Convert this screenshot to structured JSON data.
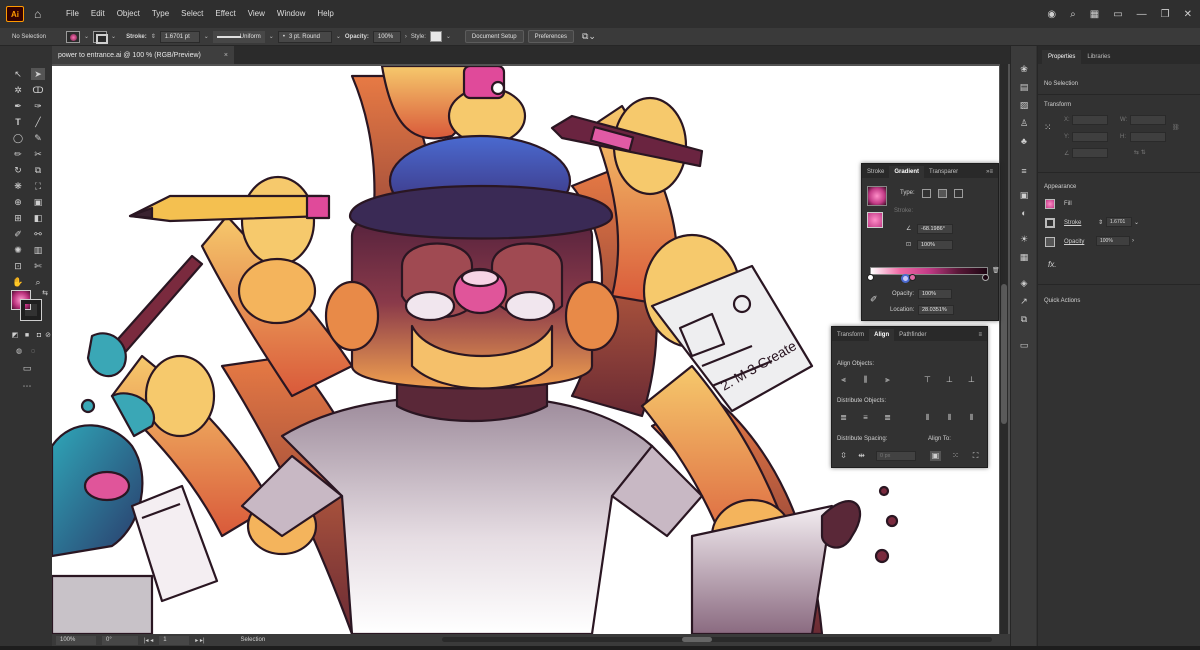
{
  "app": {
    "logo": "Ai",
    "menu": [
      "File",
      "Edit",
      "Object",
      "Type",
      "Select",
      "Effect",
      "View",
      "Window",
      "Help"
    ]
  },
  "control_bar": {
    "selection": "No Selection",
    "stroke_label": "Stroke:",
    "stroke_value": "1.6701 pt",
    "stroke_profile": "Uniform",
    "brush": "3 pt. Round",
    "opacity_label": "Opacity:",
    "opacity_value": "100%",
    "style_label": "Style:",
    "document_setup": "Document Setup",
    "preferences": "Preferences"
  },
  "document_tab": {
    "title": "power to entrance.ai @ 100 % (RGB/Preview)",
    "close": "×"
  },
  "status_bar": {
    "zoom": "100%",
    "rotation": "0°",
    "artboard": "1",
    "tool": "Selection"
  },
  "properties_panel": {
    "tabs": [
      "Properties",
      "Libraries"
    ],
    "selection": "No Selection",
    "transform_title": "Transform",
    "x": "X:",
    "y": "Y:",
    "w": "W:",
    "h": "H:",
    "appearance_title": "Appearance",
    "fill": "Fill",
    "stroke": "Stroke",
    "stroke_value": "1.6701",
    "opacity": "Opacity",
    "opacity_value": "100%",
    "fx": "fx.",
    "quick_actions": "Quick Actions"
  },
  "gradient_panel": {
    "tabs": [
      "Stroke",
      "Gradient",
      "Transparer"
    ],
    "type_label": "Type:",
    "stroke_label": "Stroke:",
    "angle": "-68.1986°",
    "aspect": "100%",
    "opacity_label": "Opacity:",
    "opacity_value": "100%",
    "location_label": "Location:",
    "location_value": "28.0351%",
    "gradient_colors": [
      "#ffffff",
      "#f06aa5",
      "#c23a86",
      "#5a1838",
      "#1c0612"
    ]
  },
  "align_panel": {
    "tabs": [
      "Transform",
      "Align",
      "Pathfinder"
    ],
    "align_objects": "Align Objects:",
    "distribute_objects": "Distribute Objects:",
    "distribute_spacing": "Distribute Spacing:",
    "align_to": "Align To:",
    "spacing_value": "0 px"
  },
  "colors": {
    "ui_dark": "#323232",
    "canvas_bg": "#535353",
    "skin_light": "#f5c56a",
    "skin_dark": "#e06a3a",
    "outline": "#2a1622",
    "hat": "#3a2a55",
    "nose": "#e0559a"
  }
}
